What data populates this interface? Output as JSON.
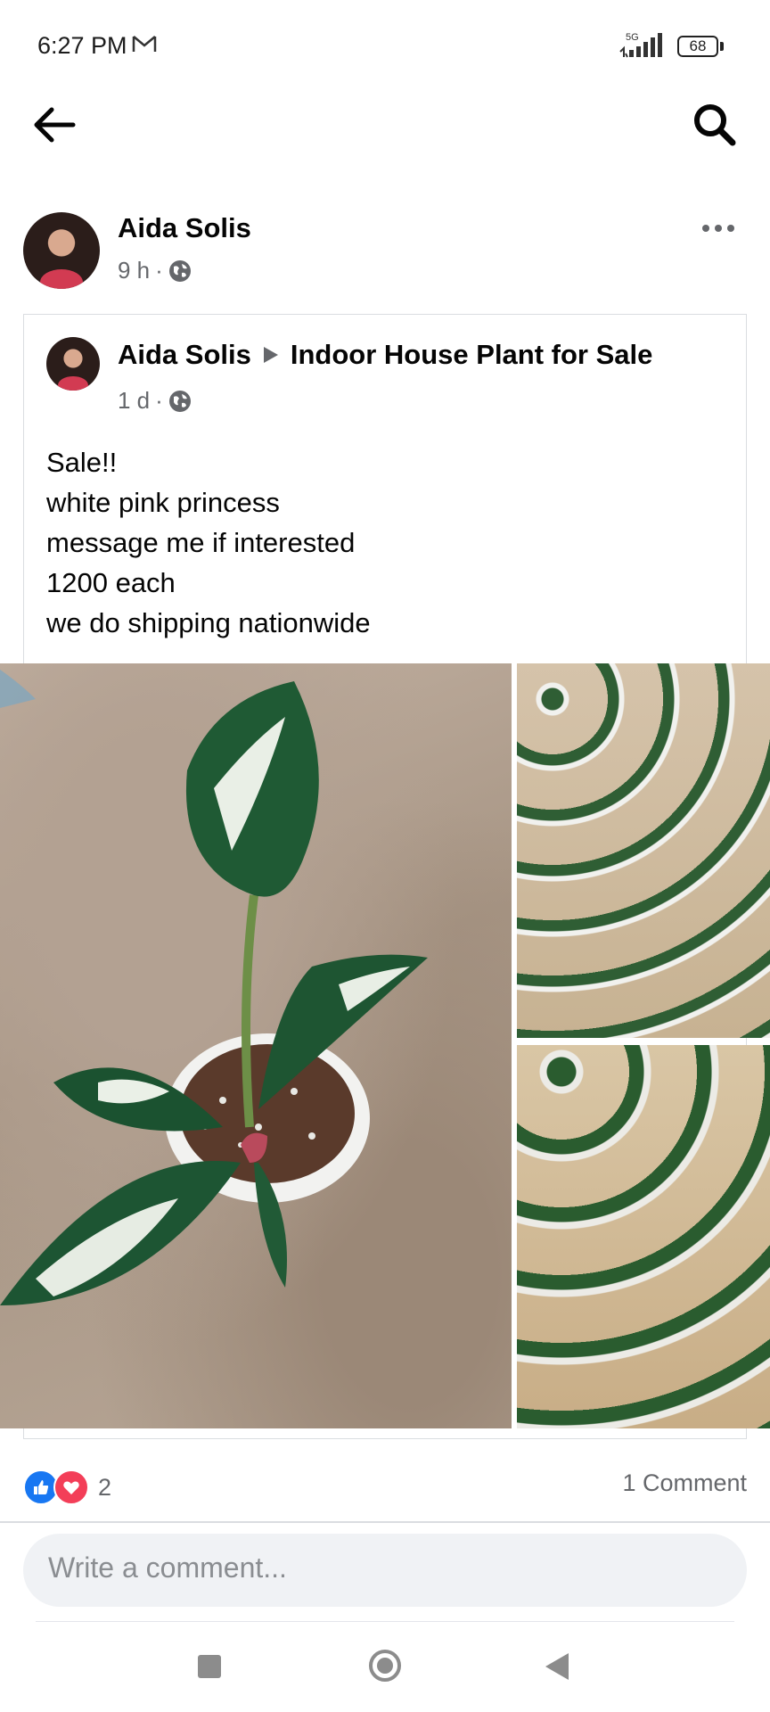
{
  "status_bar": {
    "time": "6:27 PM",
    "network": "5G",
    "battery": "68"
  },
  "header": {
    "back_icon": "arrow-left-icon",
    "search_icon": "search-icon"
  },
  "post": {
    "author": "Aida Solis",
    "time": "9 h",
    "privacy_icon": "globe-icon",
    "shared": {
      "author": "Aida Solis",
      "group": "Indoor House Plant for Sale",
      "time": "1 d",
      "text_lines": [
        "Sale!!",
        "white pink princess",
        "message me if interested",
        "1200 each",
        "we do shipping nationwide"
      ]
    },
    "reactions": {
      "count": "2",
      "types": [
        "like",
        "love"
      ]
    },
    "comments_label": "1 Comment"
  },
  "comment_box": {
    "placeholder": "Write a comment..."
  },
  "colors": {
    "accent": "#1877f2",
    "love": "#f33e58",
    "muted": "#65676b"
  }
}
